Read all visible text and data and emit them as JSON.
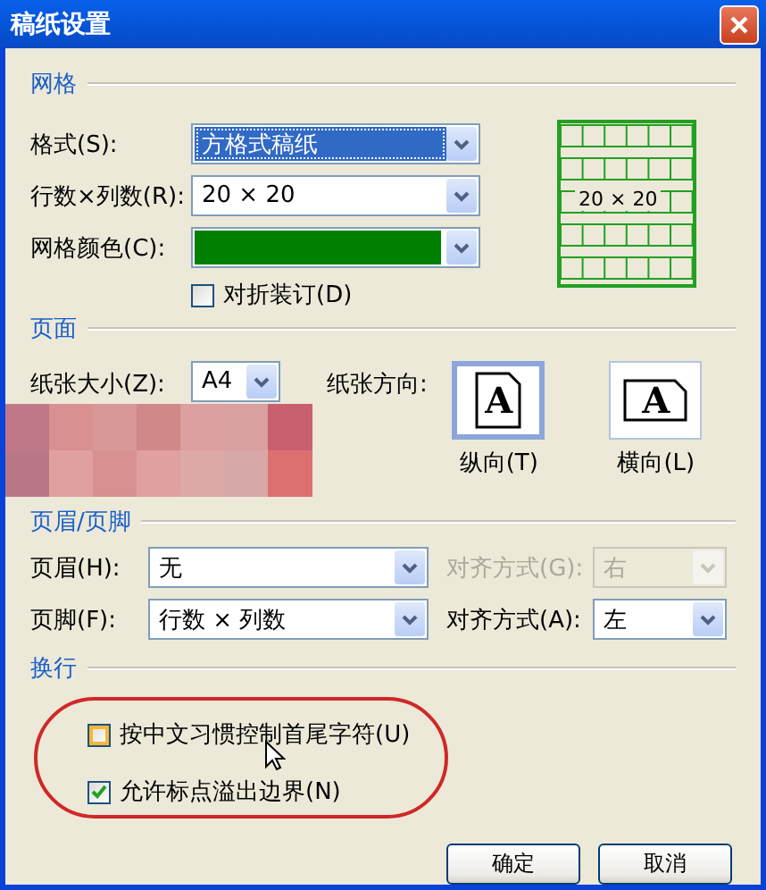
{
  "window": {
    "title": "稿纸设置"
  },
  "grid_section": {
    "title": "网格",
    "format": {
      "label": "格式(S):",
      "value": "方格式稿纸",
      "highlighted": true
    },
    "size": {
      "label": "行数×列数(R):",
      "value": "20 × 20",
      "highlighted": false
    },
    "color": {
      "label": "网格颜色(C):",
      "color": "#008000"
    },
    "fold": {
      "label": "对折装订(D)",
      "checked": false,
      "hovered": false
    },
    "preview": {
      "caption": "20 × 20"
    }
  },
  "page_section": {
    "title": "页面",
    "paper_size": {
      "label": "纸张大小(Z):",
      "value": "A4"
    },
    "orientation_label": "纸张方向:",
    "orientations": [
      {
        "glyph": "A",
        "label": "纵向(T)",
        "kind": "portrait",
        "selected": true
      },
      {
        "glyph": "A",
        "label": "横向(L)",
        "kind": "landscape",
        "selected": false
      }
    ]
  },
  "header_footer": {
    "title": "页眉/页脚",
    "rows": [
      {
        "label": "页眉(H):",
        "value": "无",
        "align_label": "对齐方式(G):",
        "align_value": "右",
        "align_disabled": true
      },
      {
        "label": "页脚(F):",
        "value": "行数 × 列数",
        "align_label": "对齐方式(A):",
        "align_value": "左",
        "align_disabled": false
      }
    ]
  },
  "wrap": {
    "title": "换行",
    "options": [
      {
        "label": "按中文习惯控制首尾字符(U)",
        "checked": false,
        "hovered": true
      },
      {
        "label": "允许标点溢出边界(N)",
        "checked": true,
        "hovered": false
      }
    ]
  },
  "buttons": [
    "确定",
    "取消"
  ]
}
